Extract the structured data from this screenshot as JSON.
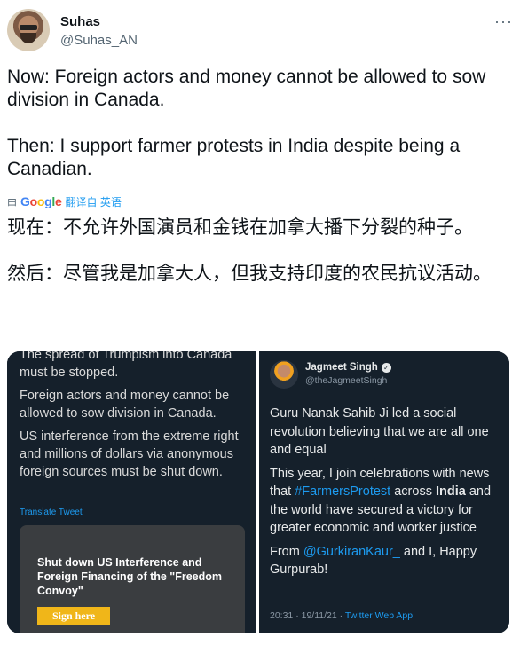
{
  "author": {
    "name": "Suhas",
    "handle": "@Suhas_AN",
    "more_icon": "more-horizontal-icon"
  },
  "tweet": {
    "text": "Now: Foreign actors and money cannot be allowed to sow division in Canada.\n\nThen: I support farmer protests in India despite being a Canadian."
  },
  "translation": {
    "by_label": "由",
    "provider": "Google",
    "action": "翻译自 英语",
    "text": "现在：不允许外国演员和金钱在加拿大播下分裂的种子。\n\n然后：尽管我是加拿大人，但我支持印度的农民抗议活动。"
  },
  "left_image": {
    "cut_line": "The spread of Trumpism into Canada",
    "line1": "must be stopped.",
    "para2": "Foreign actors and money cannot be allowed to sow division in Canada.",
    "para3": "US interference from the extreme right and millions of dollars via anonymous foreign sources must be shut down.",
    "translate_link": "Translate Tweet",
    "card_title": "Shut down US Interference and Foreign Financing of the \"Freedom Convoy\"",
    "card_button": "Sign here"
  },
  "right_image": {
    "name": "Jagmeet Singh",
    "handle": "@theJagmeetSingh",
    "para1": "Guru Nanak Sahib Ji led a social revolution believing that we are all one and equal",
    "p2_a": "This year, I join celebrations with news that ",
    "p2_hashtag": "#FarmersProtest",
    "p2_b": " across ",
    "p2_bold": "India",
    "p2_c": " and the world have secured a victory for greater economic and worker justice",
    "p3_a": "From ",
    "p3_mention": "@GurkiranKaur_",
    "p3_b": " and I, Happy Gurpurab!",
    "time": "20:31 · 19/11/21 · ",
    "source": "Twitter Web App"
  },
  "colors": {
    "link": "#1d9bf0",
    "dark_bg": "#15202b",
    "button": "#f0b619"
  }
}
